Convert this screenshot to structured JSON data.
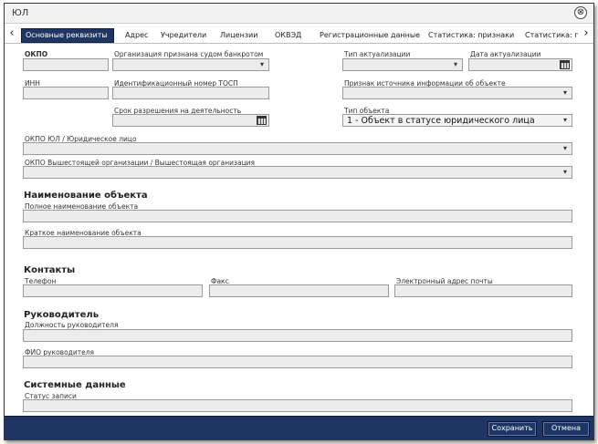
{
  "window": {
    "title": "ЮЛ",
    "close_icon": "⊗"
  },
  "tabs": [
    {
      "label": "Основные реквизиты",
      "active": true
    },
    {
      "label": "Адрес"
    },
    {
      "label": "Учредители"
    },
    {
      "label": "Лицензии"
    },
    {
      "label": "ОКВЭД"
    },
    {
      "label": "Регистрационные данные"
    },
    {
      "label": "Статистика: признаки"
    },
    {
      "label": "Статистика: п"
    }
  ],
  "tab_nav": {
    "left": "‹",
    "right": "›"
  },
  "fields": {
    "okpo": {
      "label": "ОКПО",
      "value": ""
    },
    "bankrupt": {
      "label": "Организация признана судом банкротом",
      "value": ""
    },
    "actualization_type": {
      "label": "Тип актуализации",
      "value": ""
    },
    "actualization_date": {
      "label": "Дата актуализации",
      "value": ""
    },
    "inn": {
      "label": "ИНН",
      "value": ""
    },
    "tosp": {
      "label": "Идентификационный номер ТОСП",
      "value": ""
    },
    "source_sign": {
      "label": "Признак источника информации об объекте",
      "value": ""
    },
    "activity_period": {
      "label": "Срок разрешения на деятельность",
      "value": ""
    },
    "object_type": {
      "label": "Тип объекта",
      "value": "1 - Объект в статусе юридического лица"
    },
    "okpo_legal": {
      "label": "ОКПО ЮЛ / Юридическое лицо",
      "value": ""
    },
    "okpo_parent": {
      "label": "ОКПО Вышестоящей организации / Вышестоящая организация",
      "value": ""
    },
    "full_name": {
      "label": "Полное наименование объекта",
      "value": ""
    },
    "short_name": {
      "label": "Краткое наименование объекта",
      "value": ""
    },
    "phone": {
      "label": "Телефон",
      "value": ""
    },
    "fax": {
      "label": "Факс",
      "value": ""
    },
    "email": {
      "label": "Электронный адрес почты",
      "value": ""
    },
    "head_position": {
      "label": "Должность руководителя",
      "value": ""
    },
    "head_name": {
      "label": "ФИО руководителя",
      "value": ""
    },
    "record_status": {
      "label": "Статус записи",
      "value": ""
    }
  },
  "sections": {
    "name": "Наименование объекта",
    "contacts": "Контакты",
    "head": "Руководитель",
    "system": "Системные данные"
  },
  "footer": {
    "save_label": "Сохранить",
    "cancel_label": "Отмена"
  },
  "colors": {
    "accent": "#1f3564",
    "field_bg": "#ececec",
    "border": "#9a9a9a"
  }
}
